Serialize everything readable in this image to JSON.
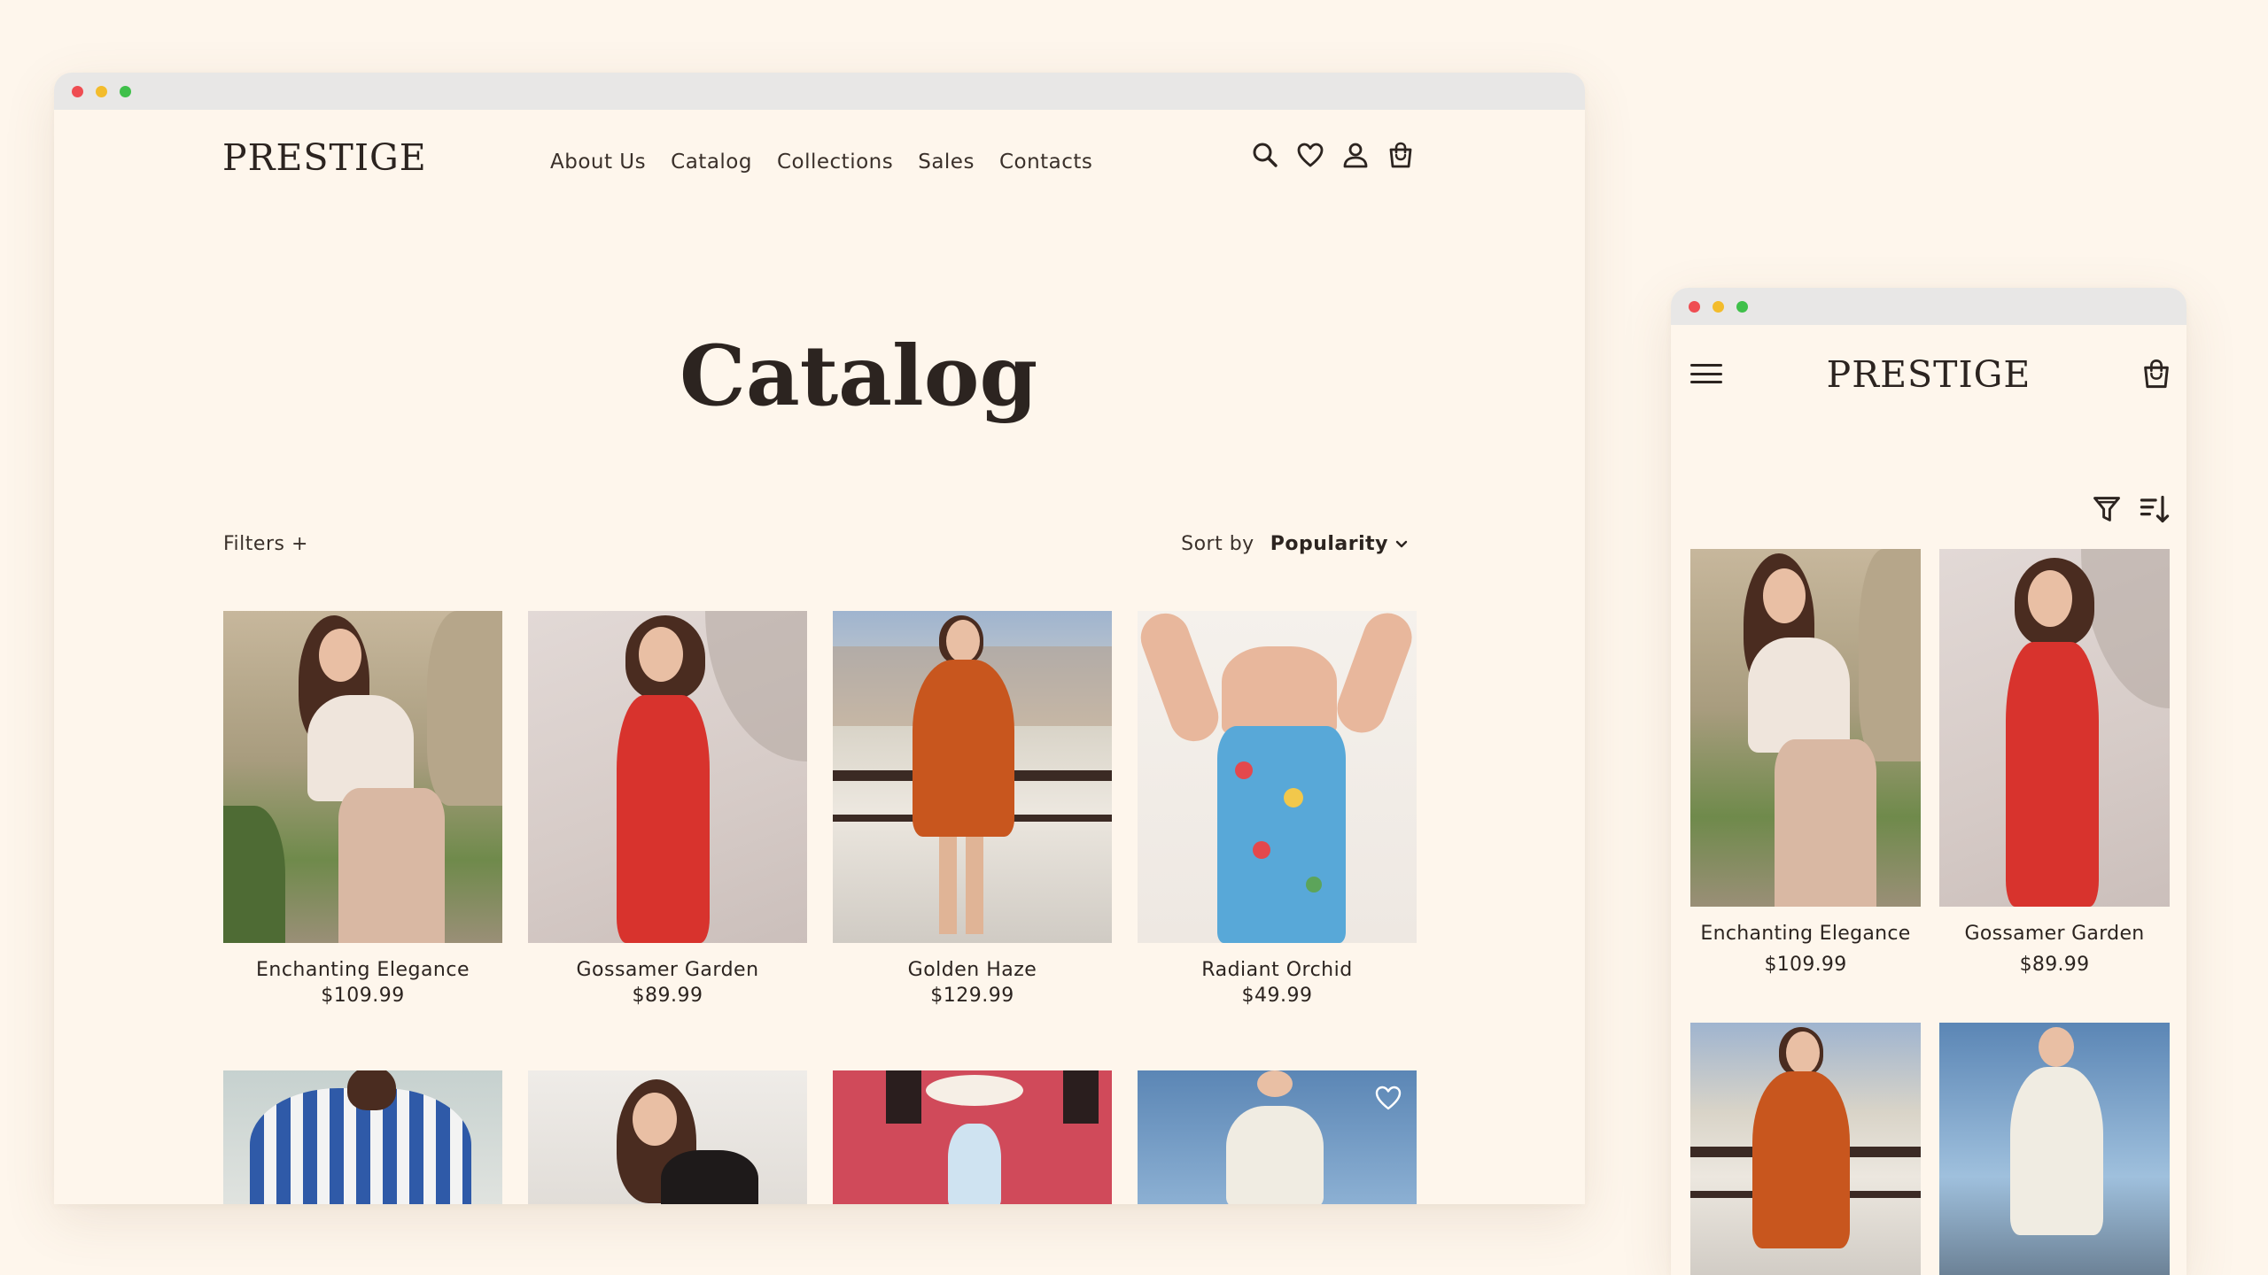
{
  "desktop": {
    "logo": "PRESTIGE",
    "nav": [
      "About Us",
      "Catalog",
      "Collections",
      "Sales",
      "Contacts"
    ],
    "icons": [
      "search-icon",
      "heart-icon",
      "user-icon",
      "shopping-bag-icon"
    ],
    "page_title": "Catalog",
    "filters_label": "Filters +",
    "sort_label": "Sort by",
    "sort_value": "Popularity",
    "products": [
      {
        "name": "Enchanting Elegance",
        "price": "$109.99"
      },
      {
        "name": "Gossamer Garden",
        "price": "$89.99"
      },
      {
        "name": "Golden Haze",
        "price": "$129.99"
      },
      {
        "name": "Radiant Orchid",
        "price": "$49.99"
      }
    ]
  },
  "mobile": {
    "logo": "PRESTIGE",
    "icons": [
      "menu-icon",
      "shopping-bag-icon",
      "filter-icon",
      "sort-icon"
    ],
    "products": [
      {
        "name": "Enchanting Elegance",
        "price": "$109.99"
      },
      {
        "name": "Gossamer Garden",
        "price": "$89.99"
      }
    ]
  },
  "colors": {
    "background": "#fef6ec",
    "text": "#2c2420",
    "chrome": "#e8e7e6"
  }
}
